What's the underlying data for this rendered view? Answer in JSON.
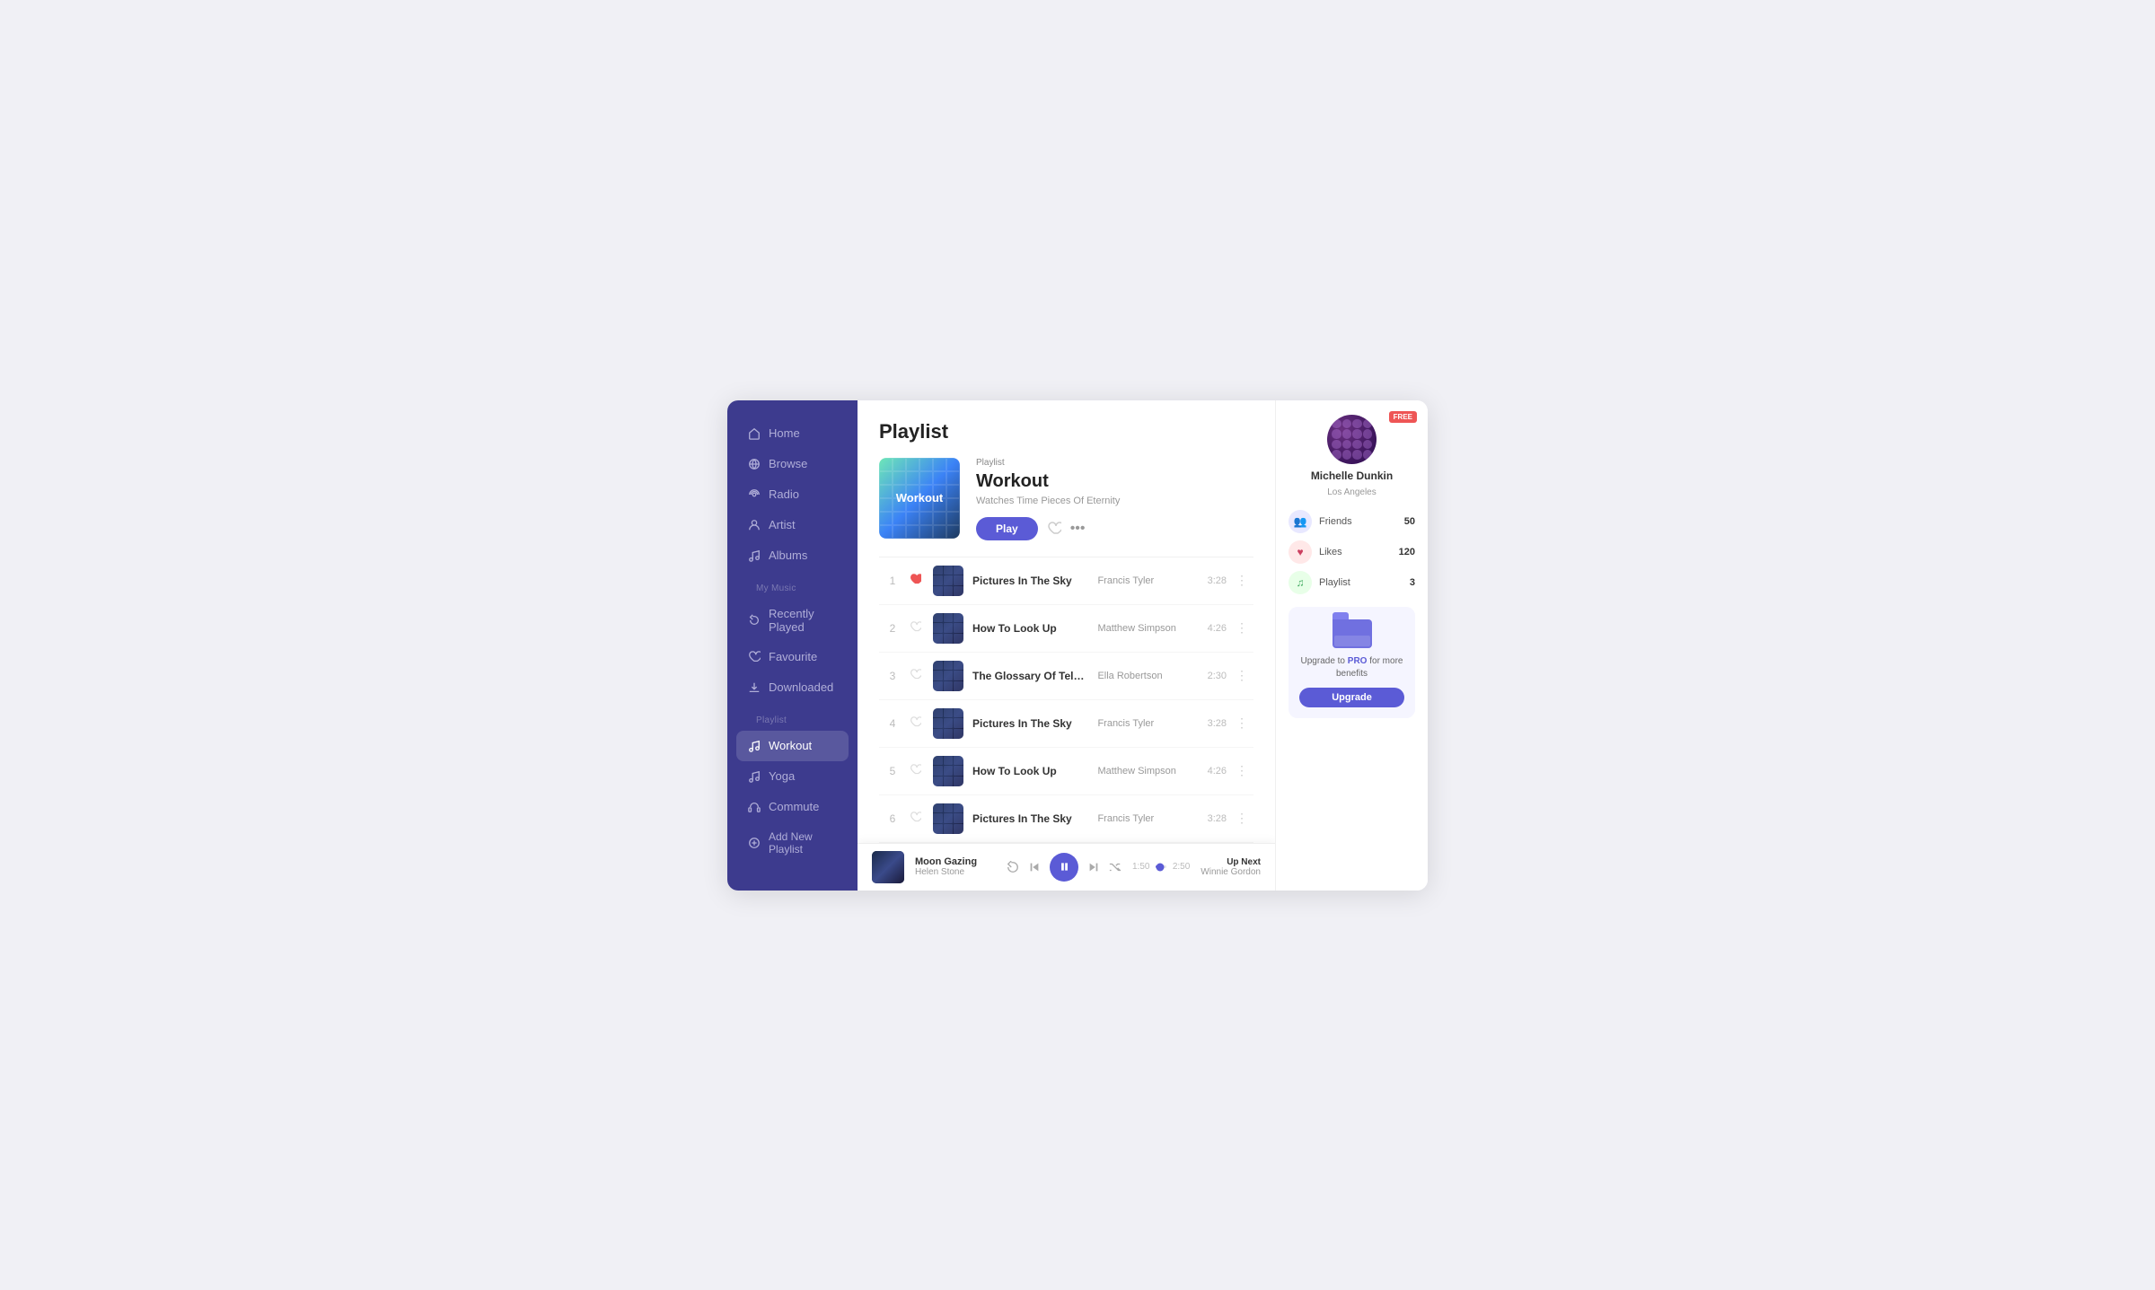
{
  "sidebar": {
    "nav_items": [
      {
        "id": "home",
        "label": "Home",
        "icon": "home"
      },
      {
        "id": "browse",
        "label": "Browse",
        "icon": "globe"
      },
      {
        "id": "radio",
        "label": "Radio",
        "icon": "radio"
      },
      {
        "id": "artist",
        "label": "Artist",
        "icon": "person"
      },
      {
        "id": "albums",
        "label": "Albums",
        "icon": "music-note"
      }
    ],
    "my_music_label": "My Music",
    "my_music_items": [
      {
        "id": "recently-played",
        "label": "Recently Played",
        "icon": "refresh"
      },
      {
        "id": "favourite",
        "label": "Favourite",
        "icon": "heart"
      },
      {
        "id": "downloaded",
        "label": "Downloaded",
        "icon": "download"
      }
    ],
    "playlist_label": "Playlist",
    "playlist_items": [
      {
        "id": "workout",
        "label": "Workout",
        "icon": "music",
        "active": true
      },
      {
        "id": "yoga",
        "label": "Yoga",
        "icon": "music"
      },
      {
        "id": "commute",
        "label": "Commute",
        "icon": "headphones"
      }
    ],
    "add_playlist_label": "Add New Playlist"
  },
  "main": {
    "page_title": "Playlist",
    "playlist": {
      "tag": "Playlist",
      "name": "Workout",
      "subtitle": "Watches Time Pieces Of Eternity",
      "cover_label": "Workout",
      "play_button": "Play"
    },
    "tracks": [
      {
        "num": "1",
        "title": "Pictures In The Sky",
        "artist": "Francis Tyler",
        "duration": "3:28",
        "liked": true
      },
      {
        "num": "2",
        "title": "How To Look Up",
        "artist": "Matthew Simpson",
        "duration": "4:26",
        "liked": false
      },
      {
        "num": "3",
        "title": "The Glossary Of Telescopes",
        "artist": "Ella Robertson",
        "duration": "2:30",
        "liked": false
      },
      {
        "num": "4",
        "title": "Pictures In The Sky",
        "artist": "Francis Tyler",
        "duration": "3:28",
        "liked": false
      },
      {
        "num": "5",
        "title": "How To Look Up",
        "artist": "Matthew Simpson",
        "duration": "4:26",
        "liked": false
      },
      {
        "num": "6",
        "title": "Pictures In The Sky",
        "artist": "Francis Tyler",
        "duration": "3:28",
        "liked": false
      }
    ]
  },
  "player": {
    "song_title": "Moon Gazing",
    "artist": "Helen Stone",
    "current_time": "1:50",
    "total_time": "2:50",
    "progress_percent": 42
  },
  "up_next": {
    "label": "Up Next",
    "artist": "Winnie Gordon"
  },
  "right_panel": {
    "free_badge": "FREE",
    "user": {
      "name": "Michelle Dunkin",
      "location": "Los Angeles"
    },
    "stats": [
      {
        "id": "friends",
        "label": "Friends",
        "value": "50",
        "type": "friends"
      },
      {
        "id": "likes",
        "label": "Likes",
        "value": "120",
        "type": "likes"
      },
      {
        "id": "playlist",
        "label": "Playlist",
        "value": "3",
        "type": "playlist"
      }
    ],
    "upgrade": {
      "text_before": "Upgrade to ",
      "text_pro": "PRO",
      "text_after": " for more benefits",
      "button": "Upgrade"
    }
  }
}
